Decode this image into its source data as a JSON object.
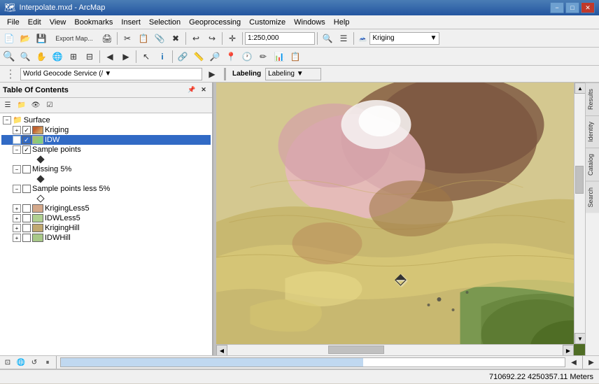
{
  "titleBar": {
    "title": "Interpolate.mxd - ArcMap",
    "iconLabel": "arcmap-icon",
    "minBtn": "−",
    "maxBtn": "□",
    "closeBtn": "✕"
  },
  "menuBar": {
    "items": [
      "File",
      "Edit",
      "View",
      "Bookmarks",
      "Insert",
      "Selection",
      "Geoprocessing",
      "Customize",
      "Windows",
      "Help"
    ]
  },
  "toolbar1": {
    "scaleValue": "1:250,000",
    "layerDropdown": "Kriging"
  },
  "addressBar": {
    "geocodeService": "World Geocode Service (/",
    "labelingBtn": "Labeling ▼"
  },
  "toc": {
    "title": "Table Of Contents",
    "layers": [
      {
        "id": "surface",
        "name": "Surface",
        "type": "group",
        "indent": 0,
        "expanded": true,
        "hasExpand": true
      },
      {
        "id": "kriging",
        "name": "Kriging",
        "type": "layer",
        "indent": 1,
        "checked": true,
        "expanded": false,
        "hasExpand": true
      },
      {
        "id": "idw",
        "name": "IDW",
        "type": "layer",
        "indent": 1,
        "checked": true,
        "selected": true,
        "expanded": false,
        "hasExpand": true
      },
      {
        "id": "sample-points",
        "name": "Sample points",
        "type": "layer",
        "indent": 1,
        "checked": true,
        "expanded": true,
        "hasExpand": true
      },
      {
        "id": "sp-sym",
        "name": "◆",
        "type": "symbol",
        "indent": 3
      },
      {
        "id": "missing5",
        "name": "Missing 5%",
        "type": "layer",
        "indent": 1,
        "checked": false,
        "expanded": true,
        "hasExpand": true
      },
      {
        "id": "m5-sym",
        "name": "◆",
        "type": "symbol",
        "indent": 3
      },
      {
        "id": "sample-less5",
        "name": "Sample points less 5%",
        "type": "layer",
        "indent": 1,
        "checked": false,
        "expanded": true,
        "hasExpand": true
      },
      {
        "id": "sl5-sym",
        "name": "◇",
        "type": "symbol",
        "indent": 3
      },
      {
        "id": "krigingless5",
        "name": "KrigingLess5",
        "type": "layer",
        "indent": 1,
        "checked": false,
        "expanded": false,
        "hasExpand": true
      },
      {
        "id": "idwless5",
        "name": "IDWLess5",
        "type": "layer",
        "indent": 1,
        "checked": false,
        "expanded": false,
        "hasExpand": true
      },
      {
        "id": "kriginghill",
        "name": "KrigingHill",
        "type": "layer",
        "indent": 1,
        "checked": false,
        "expanded": false,
        "hasExpand": true
      },
      {
        "id": "idwhill",
        "name": "IDWHill",
        "type": "layer",
        "indent": 1,
        "checked": false,
        "expanded": false,
        "hasExpand": true
      }
    ]
  },
  "rightTabs": [
    "Results",
    "Identity",
    "Catalog",
    "Search"
  ],
  "statusBar": {
    "coords": "710692.22  4250357.11 Meters"
  },
  "mapScrollbar": {
    "hScrollPos": 50,
    "vScrollPos": 50
  }
}
